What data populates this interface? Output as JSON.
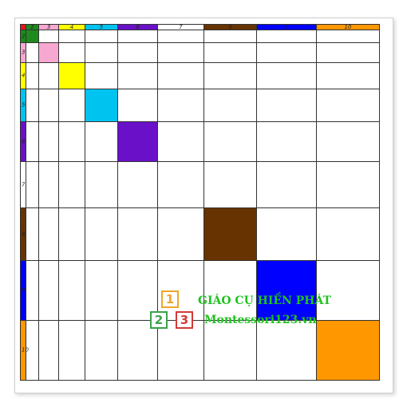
{
  "grid": {
    "labels": [
      "1",
      "2",
      "3",
      "4",
      "5",
      "6",
      "7",
      "8",
      "9",
      "10"
    ],
    "colors": [
      "#e8141e",
      "#1e8a1e",
      "#f7a8d0",
      "#ffff00",
      "#00c3f0",
      "#6a10c8",
      "#ffffff",
      "#673300",
      "#0000ff",
      "#ff9700"
    ]
  },
  "watermark": {
    "cube_1": "1",
    "cube_2": "2",
    "cube_3": "3",
    "title": "GIÁO CỤ HIỀN PHÁT",
    "url": "Montessori123.vn"
  }
}
